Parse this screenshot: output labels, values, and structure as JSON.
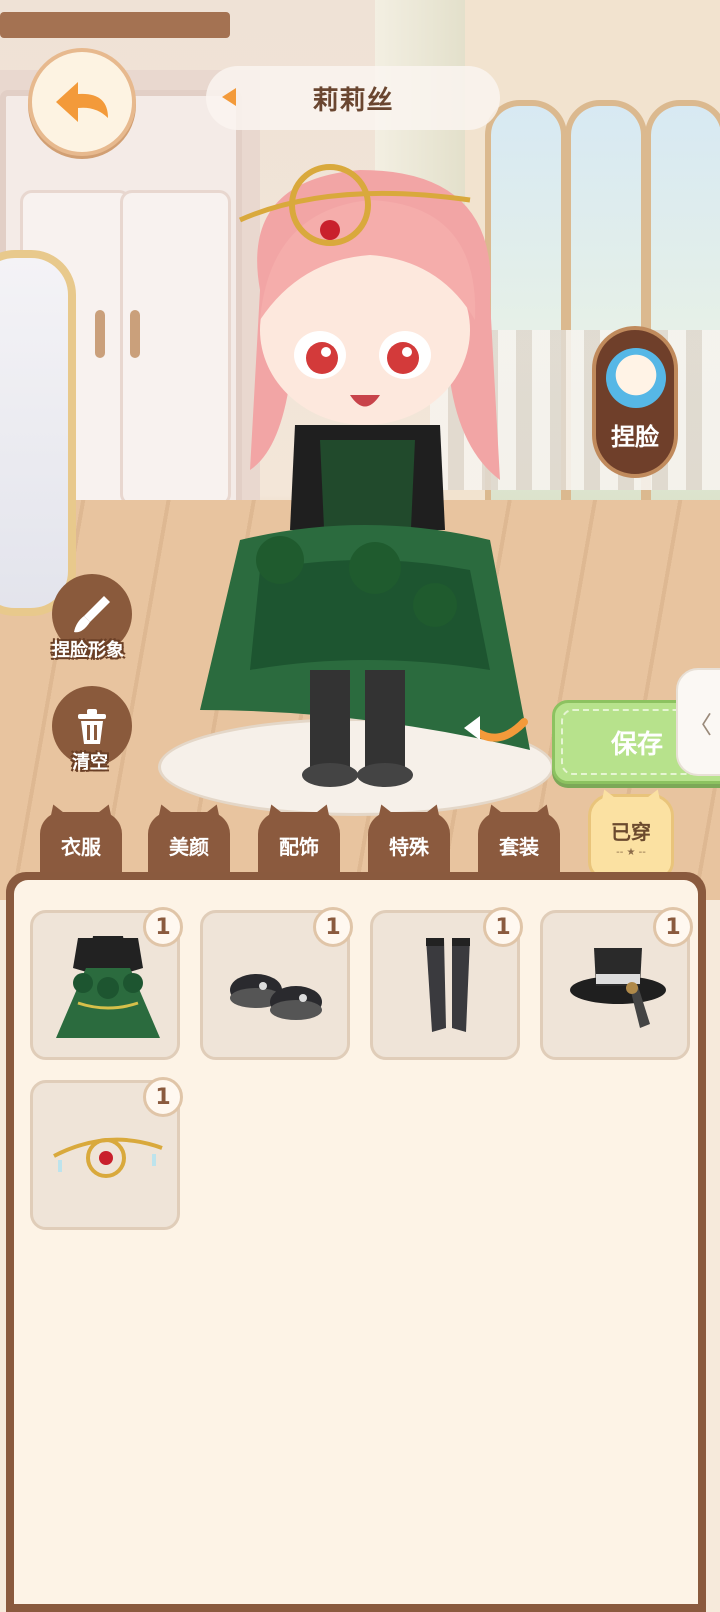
{
  "character": {
    "name": "莉莉丝"
  },
  "buttons": {
    "face_sculpt": "捏脸",
    "face_image": "捏脸形象",
    "clear": "清空",
    "save": "保存",
    "side_tab": "〈"
  },
  "tabs": [
    {
      "label": "衣服",
      "active": false
    },
    {
      "label": "美颜",
      "active": false
    },
    {
      "label": "配饰",
      "active": false
    },
    {
      "label": "特殊",
      "active": false
    },
    {
      "label": "套装",
      "active": false
    },
    {
      "label": "已穿",
      "active": true
    }
  ],
  "tab_active_deco": "-- ★ --",
  "items": [
    {
      "icon": "green-gothic-dress-icon",
      "count": "1"
    },
    {
      "icon": "black-platform-shoes-icon",
      "count": "1"
    },
    {
      "icon": "black-stockings-icon",
      "count": "1"
    },
    {
      "icon": "black-top-hat-icon",
      "count": "1"
    },
    {
      "icon": "golden-tiara-icon",
      "count": "1"
    }
  ],
  "colors": {
    "accent_orange": "#f39a3a",
    "wood_brown": "#8b5a3e",
    "save_green": "#b7e28c",
    "active_tab": "#fbe1a2",
    "panel_bg": "#fdf3e6"
  }
}
